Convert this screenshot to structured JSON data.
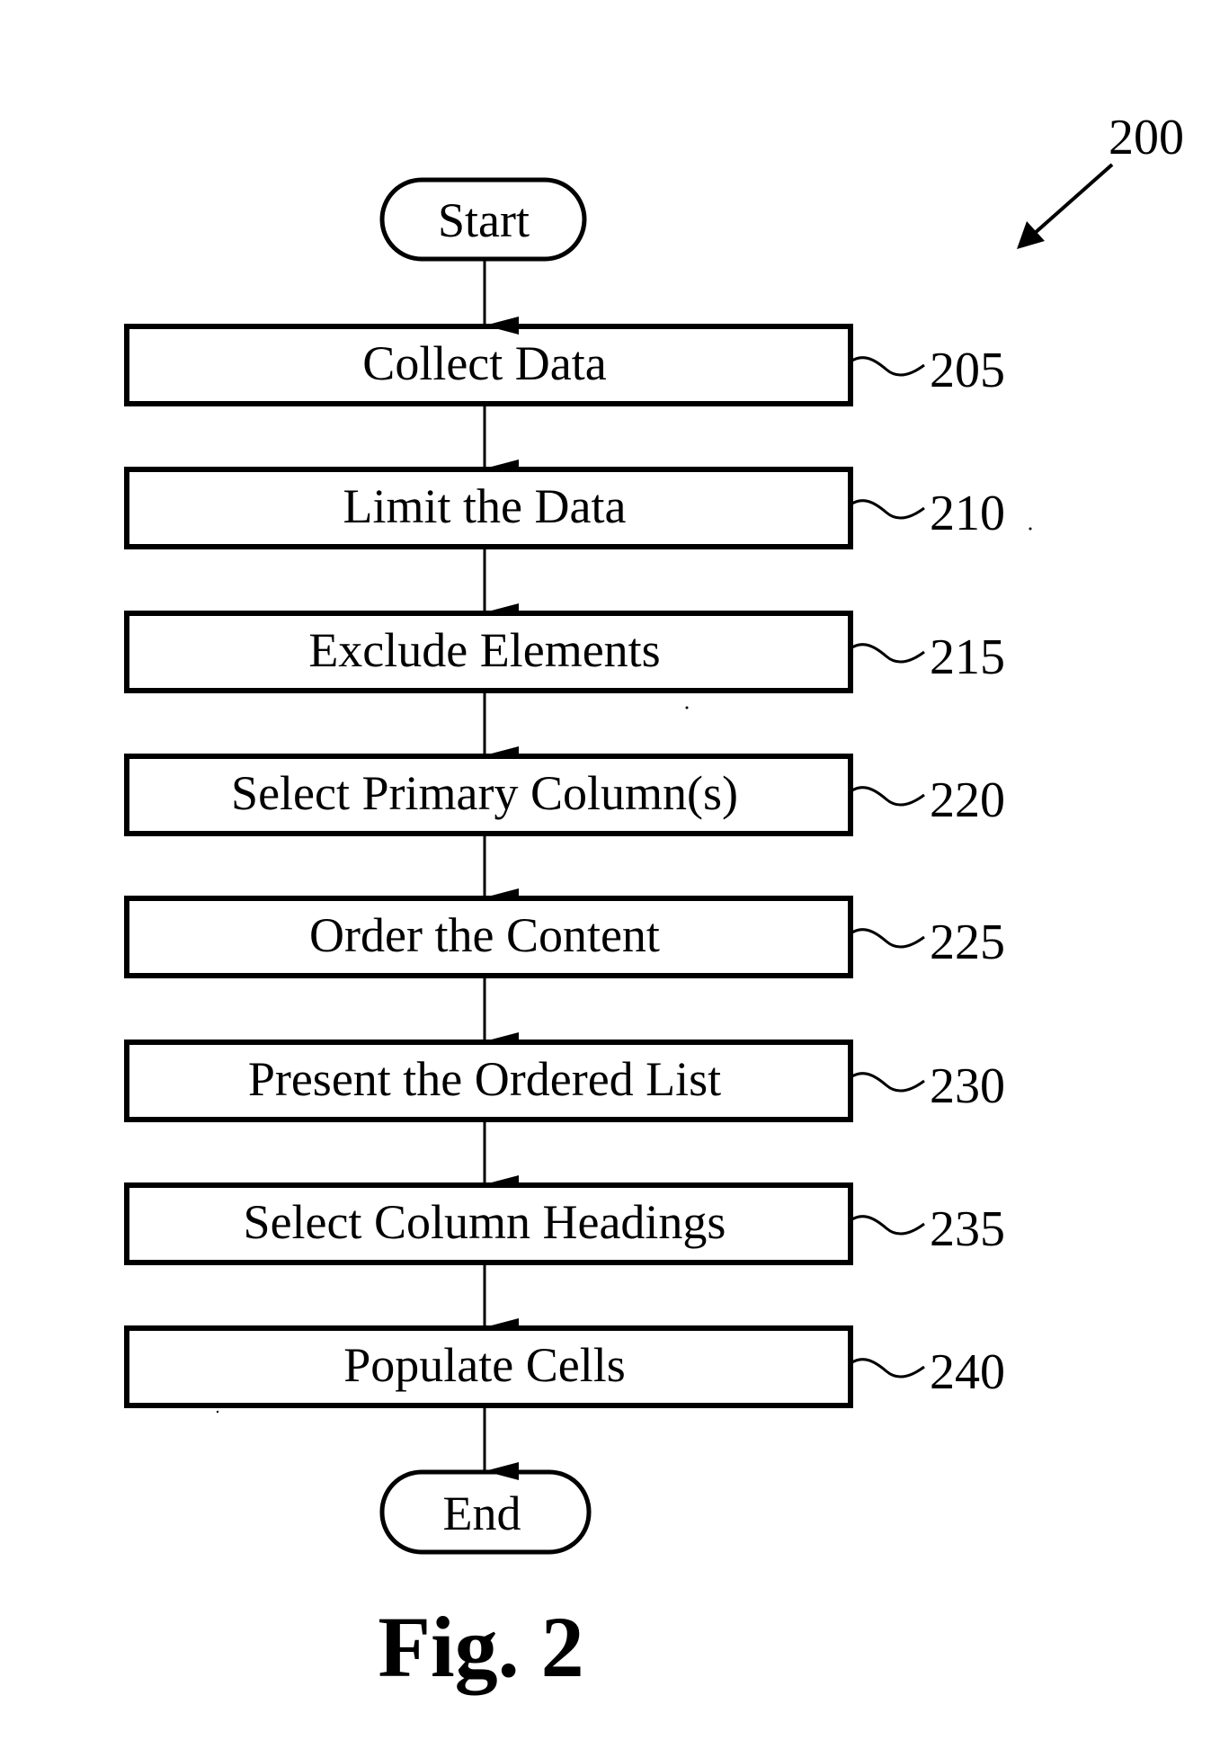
{
  "figure": {
    "reference_number": "200",
    "caption": "Fig. 2",
    "start_label": "Start",
    "end_label": "End",
    "steps": [
      {
        "label": "Collect Data",
        "ref": "205"
      },
      {
        "label": "Limit the Data",
        "ref": "210"
      },
      {
        "label": "Exclude Elements",
        "ref": "215"
      },
      {
        "label": "Select Primary Column(s)",
        "ref": "220"
      },
      {
        "label": "Order the Content",
        "ref": "225"
      },
      {
        "label": "Present the Ordered List",
        "ref": "230"
      },
      {
        "label": "Select Column Headings",
        "ref": "235"
      },
      {
        "label": "Populate Cells",
        "ref": "240"
      }
    ]
  }
}
